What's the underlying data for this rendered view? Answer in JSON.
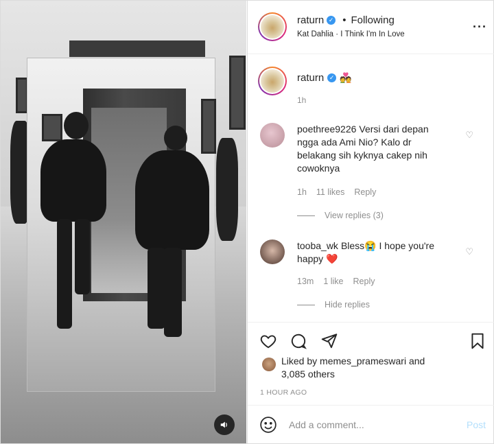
{
  "post": {
    "username": "raturn",
    "following_label": "Following",
    "audio_artist": "Kat Dahlia",
    "audio_track": "I Think I'm In Love",
    "caption_emoji": "💑",
    "caption_time": "1h"
  },
  "comments": [
    {
      "username": "poethree9226",
      "text": "Versi dari depan ngga ada Ami Nio? Kalo dr belakang sih kyknya cakep nih cowoknya",
      "time": "1h",
      "likes": "11 likes",
      "reply_label": "Reply",
      "replies_toggle": "View replies (3)"
    },
    {
      "username": "tooba_wk",
      "text": "Bless😭 I hope you're happy ❤️",
      "time": "13m",
      "likes": "1 like",
      "reply_label": "Reply",
      "replies_toggle": "Hide replies"
    }
  ],
  "likes_summary": {
    "prefix": "Liked by ",
    "user": "memes_prameswari",
    "suffix": " and",
    "others": "3,085 others"
  },
  "time_ago": "1 HOUR AGO",
  "add_comment": {
    "placeholder": "Add a comment...",
    "post_label": "Post"
  },
  "icons": {
    "verified": "verified-badge-icon",
    "more": "more-options-icon",
    "heart": "heart-icon",
    "comment": "comment-icon",
    "share": "share-icon",
    "save": "bookmark-icon",
    "emoji": "emoji-icon",
    "mute": "speaker-icon"
  },
  "colors": {
    "accent": "#3897f0",
    "post_button": "#b2dffc",
    "muted_text": "#8e8e8e"
  }
}
